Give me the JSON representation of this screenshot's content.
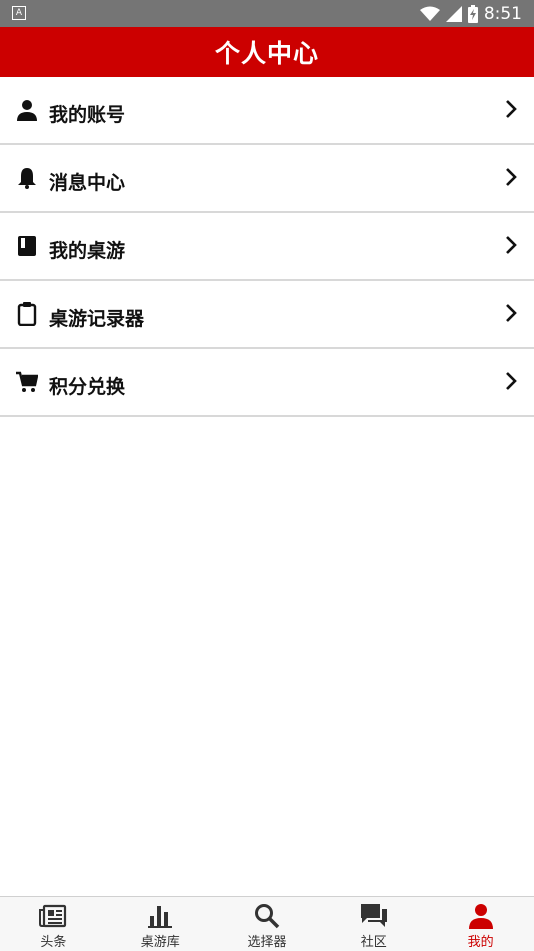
{
  "status_bar": {
    "left_badge": "A",
    "time": "8:51",
    "icons": [
      "wifi-icon",
      "cell-signal-icon",
      "battery-charging-icon"
    ]
  },
  "header": {
    "title": "个人中心",
    "background_color": "#cc0000"
  },
  "menu": {
    "items": [
      {
        "label": "我的账号",
        "icon": "person-icon"
      },
      {
        "label": "消息中心",
        "icon": "bell-icon"
      },
      {
        "label": "我的桌游",
        "icon": "book-icon"
      },
      {
        "label": "桌游记录器",
        "icon": "clipboard-icon"
      },
      {
        "label": "积分兑换",
        "icon": "cart-icon"
      }
    ]
  },
  "bottom_nav": {
    "active_color": "#cc0000",
    "items": [
      {
        "label": "头条",
        "icon": "newspaper-icon"
      },
      {
        "label": "桌游库",
        "icon": "bar-chart-icon"
      },
      {
        "label": "选择器",
        "icon": "search-icon"
      },
      {
        "label": "社区",
        "icon": "chat-icon"
      },
      {
        "label": "我的",
        "icon": "person-icon",
        "active": true
      }
    ]
  }
}
